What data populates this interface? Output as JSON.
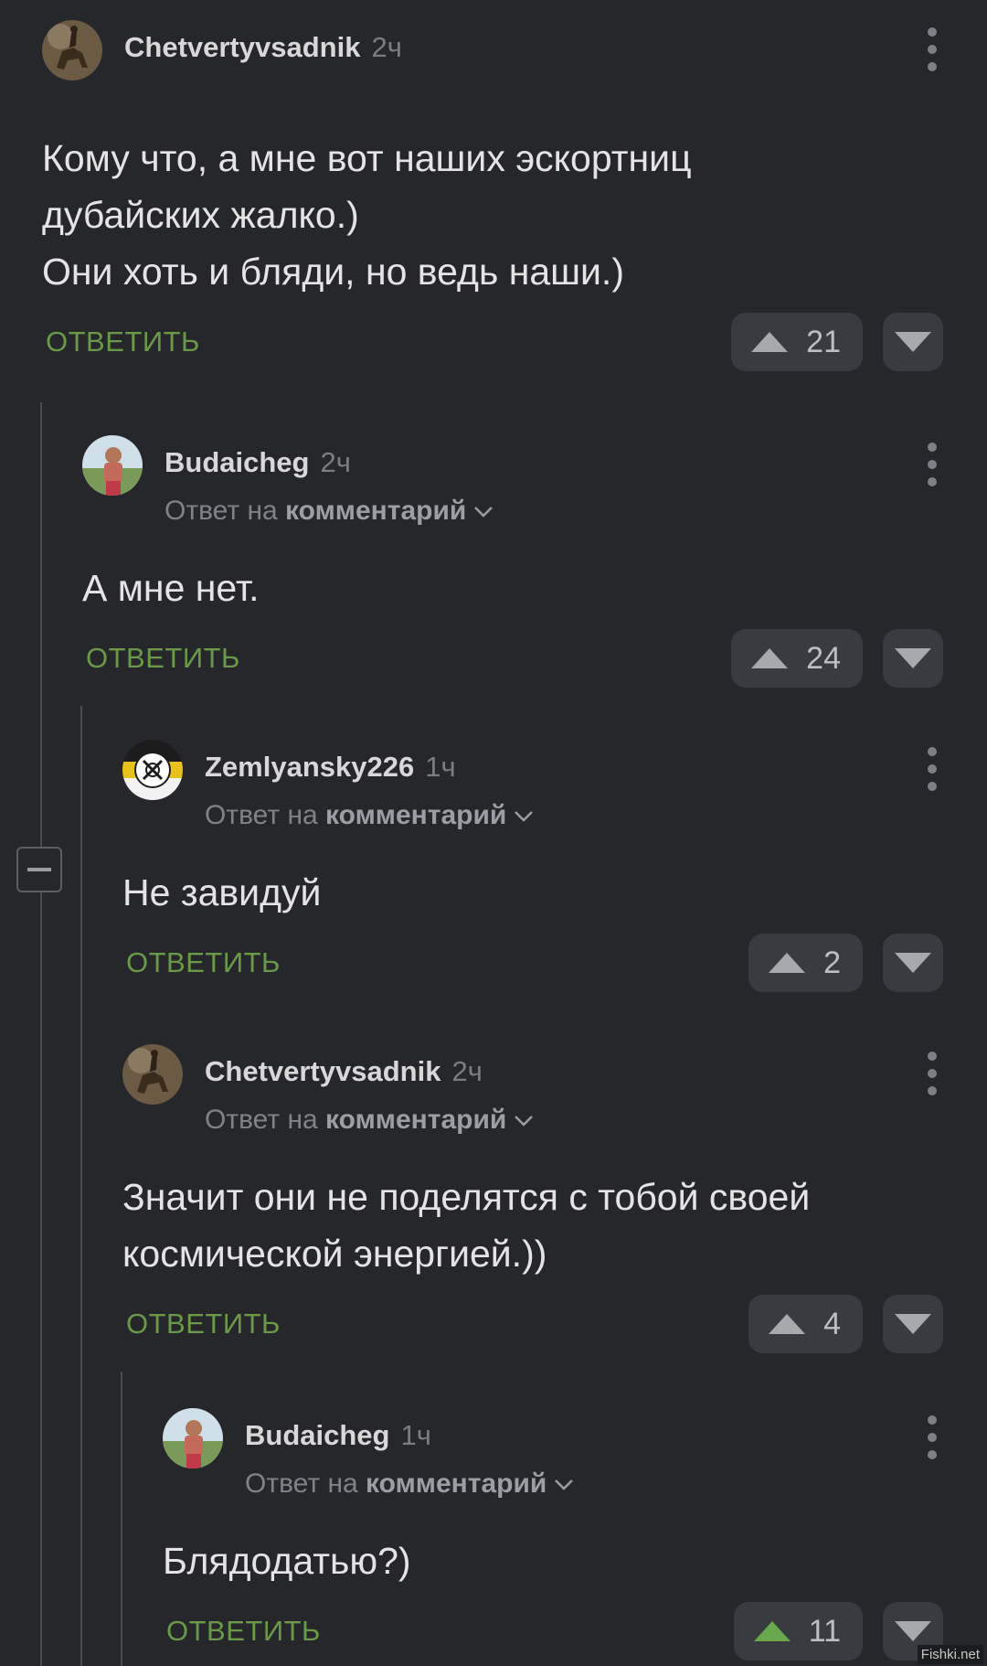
{
  "comments": [
    {
      "author": "Chetvertyvsadnik",
      "time": "2ч",
      "text": "Кому что, а мне вот наших эскортниц\nдубайских жалко.)\nОни хоть и бляди, но ведь наши.)",
      "reply_label": "ОТВЕТИТЬ",
      "rating": "21",
      "avatar_icon": "horseman-avatar"
    },
    {
      "author": "Budaicheg",
      "time": "2ч",
      "reply_to_prefix": "Ответ на",
      "reply_to_link": "комментарий",
      "text": "А мне нет.",
      "reply_label": "ОТВЕТИТЬ",
      "rating": "24",
      "avatar_icon": "person-photo-avatar"
    },
    {
      "author": "Zemlyansky226",
      "time": "1ч",
      "reply_to_prefix": "Ответ на",
      "reply_to_link": "комментарий",
      "text": "Не завидуй",
      "reply_label": "ОТВЕТИТЬ",
      "rating": "2",
      "avatar_icon": "emblem-avatar"
    },
    {
      "author": "Chetvertyvsadnik",
      "time": "2ч",
      "reply_to_prefix": "Ответ на",
      "reply_to_link": "комментарий",
      "text": "Значит они не поделятся с тобой своей\nкосмической энергией.))",
      "reply_label": "ОТВЕТИТЬ",
      "rating": "4",
      "avatar_icon": "horseman-avatar"
    },
    {
      "author": "Budaicheg",
      "time": "1ч",
      "reply_to_prefix": "Ответ на",
      "reply_to_link": "комментарий",
      "text": "Блядодатью?)",
      "reply_label": "ОТВЕТИТЬ",
      "rating": "11",
      "upvoted": true,
      "avatar_icon": "person-photo-avatar"
    }
  ],
  "colors": {
    "background": "#25272a",
    "reply_link": "#6a9a48",
    "upvote_active": "#6aa84f",
    "button_bg": "#383b40"
  },
  "watermark": "Fishki.net"
}
